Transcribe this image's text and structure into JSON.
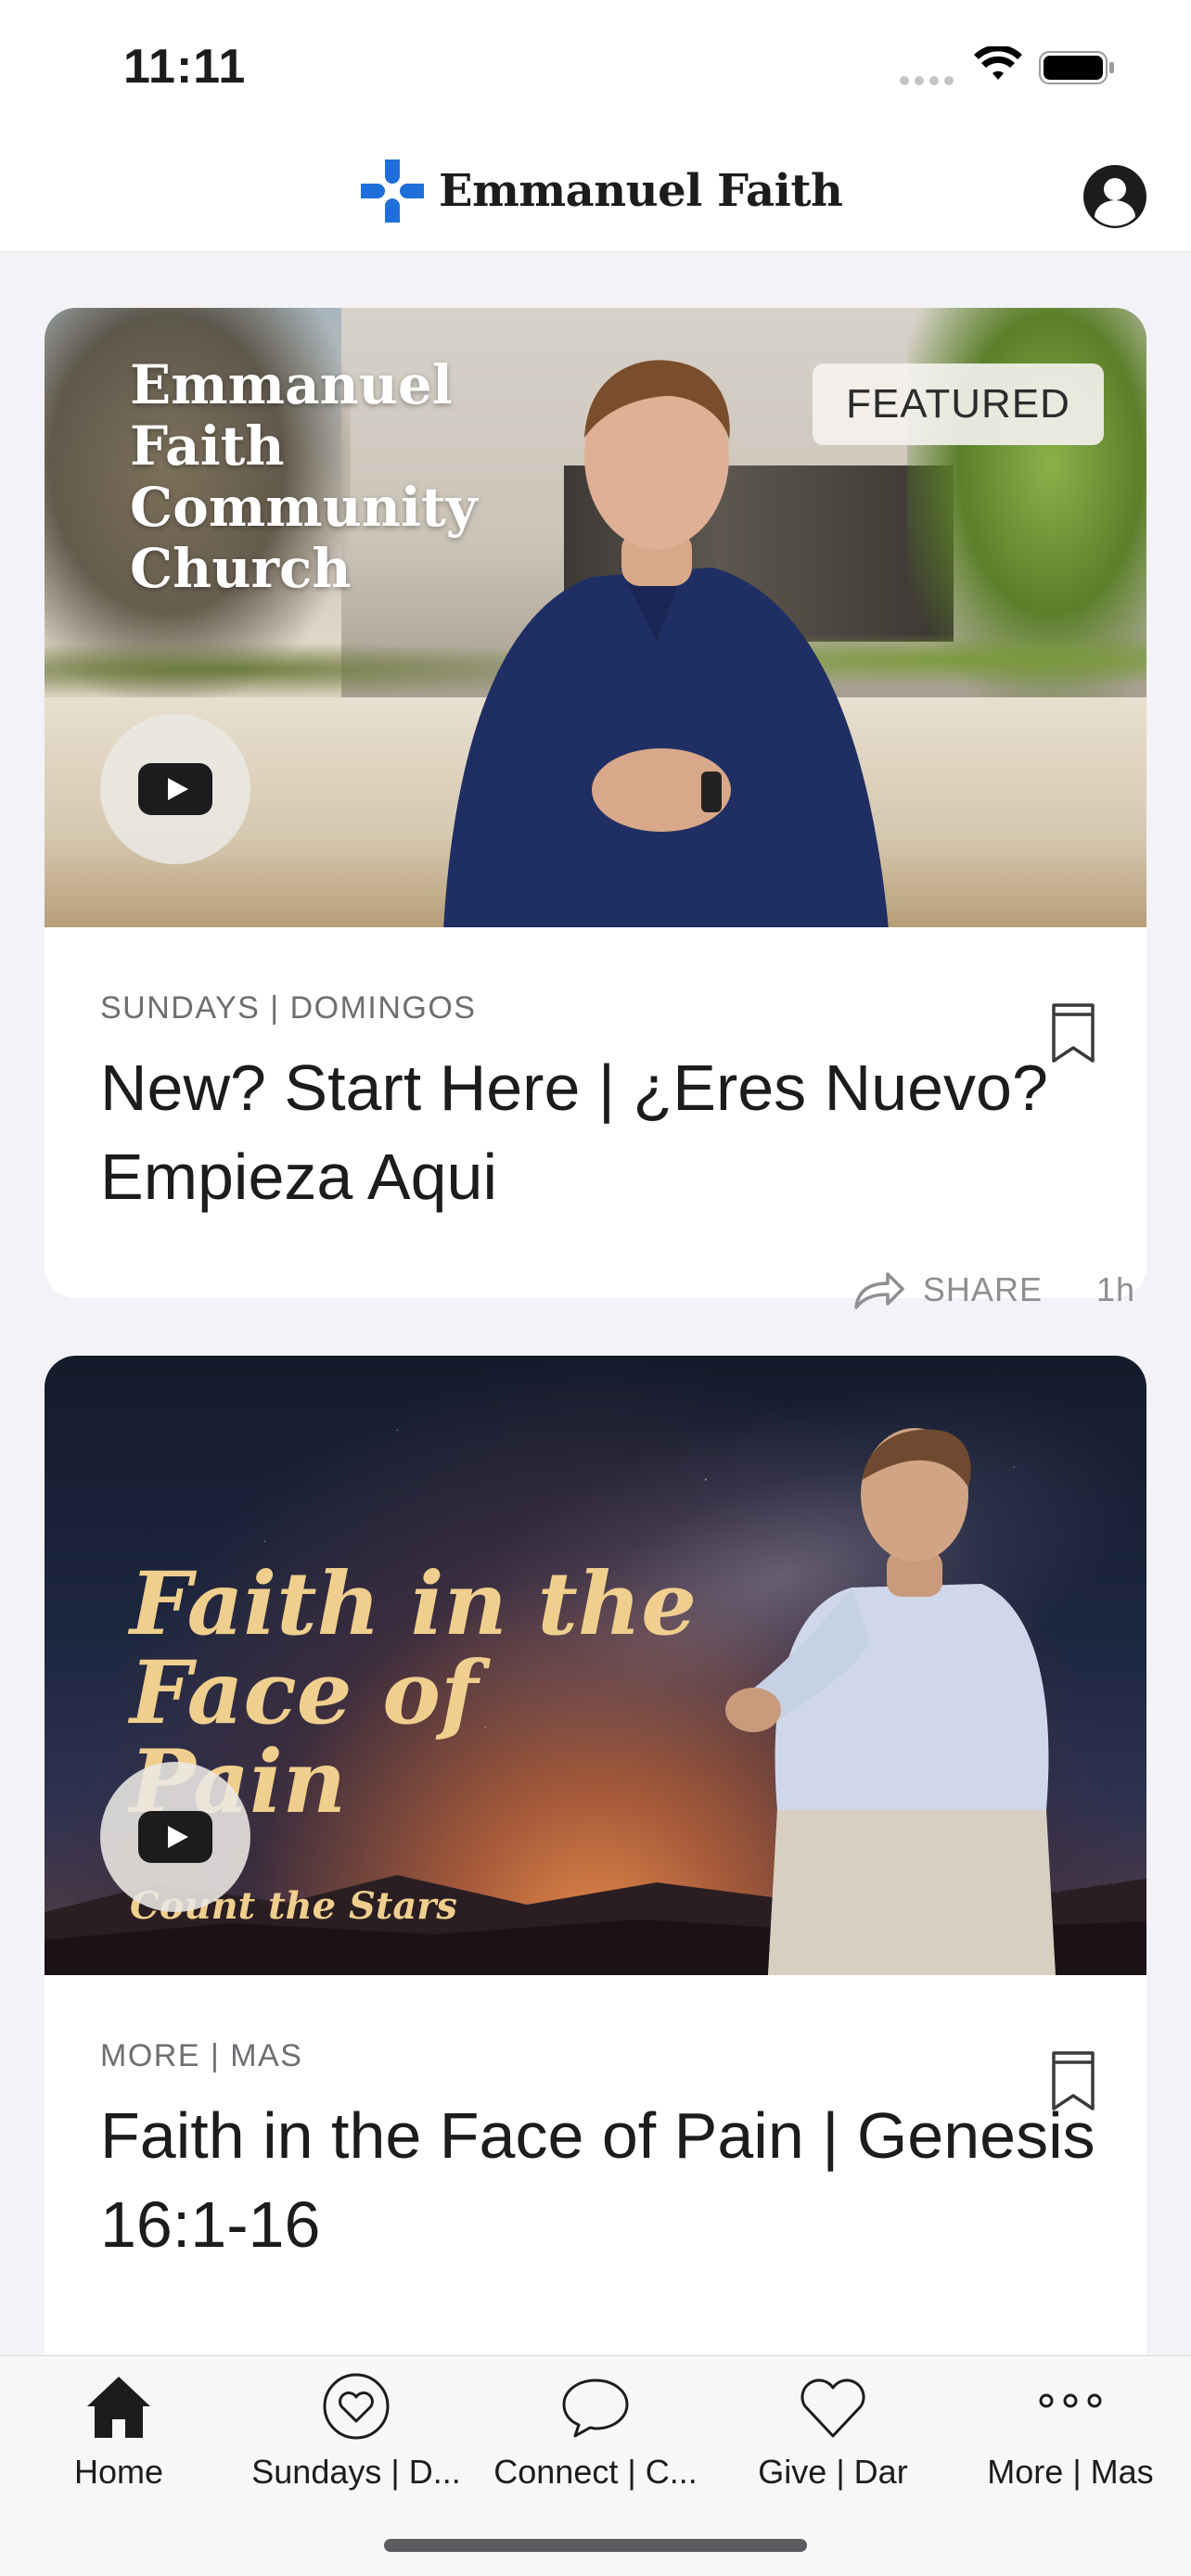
{
  "status_bar": {
    "time": "11:11"
  },
  "header": {
    "brand": "Emmanuel Faith"
  },
  "feed": [
    {
      "badge": "FEATURED",
      "overlay_title": "Emmanuel Faith Community Church",
      "category": "SUNDAYS | DOMINGOS",
      "title": "New? Start Here | ¿Eres Nuevo? Empieza Aqui"
    },
    {
      "overlay_title": "Faith in the Face of Pain",
      "overlay_subtitle": "Count the Stars",
      "category": "MORE | MAS",
      "title": "Faith in the Face of Pain | Genesis 16:1-16",
      "share_label": "SHARE",
      "time_ago": "1h"
    }
  ],
  "tabs": [
    {
      "label": "Home",
      "icon": "home-icon"
    },
    {
      "label": "Sundays | D...",
      "icon": "heart-circle-icon"
    },
    {
      "label": "Connect | C...",
      "icon": "chat-bubble-icon"
    },
    {
      "label": "Give | Dar",
      "icon": "heart-icon"
    },
    {
      "label": "More | Mas",
      "icon": "more-dots-icon"
    }
  ],
  "colors": {
    "brand_blue": "#1e6fd9",
    "gold_text": "#f0cf8e",
    "background": "#f2f2f7"
  }
}
